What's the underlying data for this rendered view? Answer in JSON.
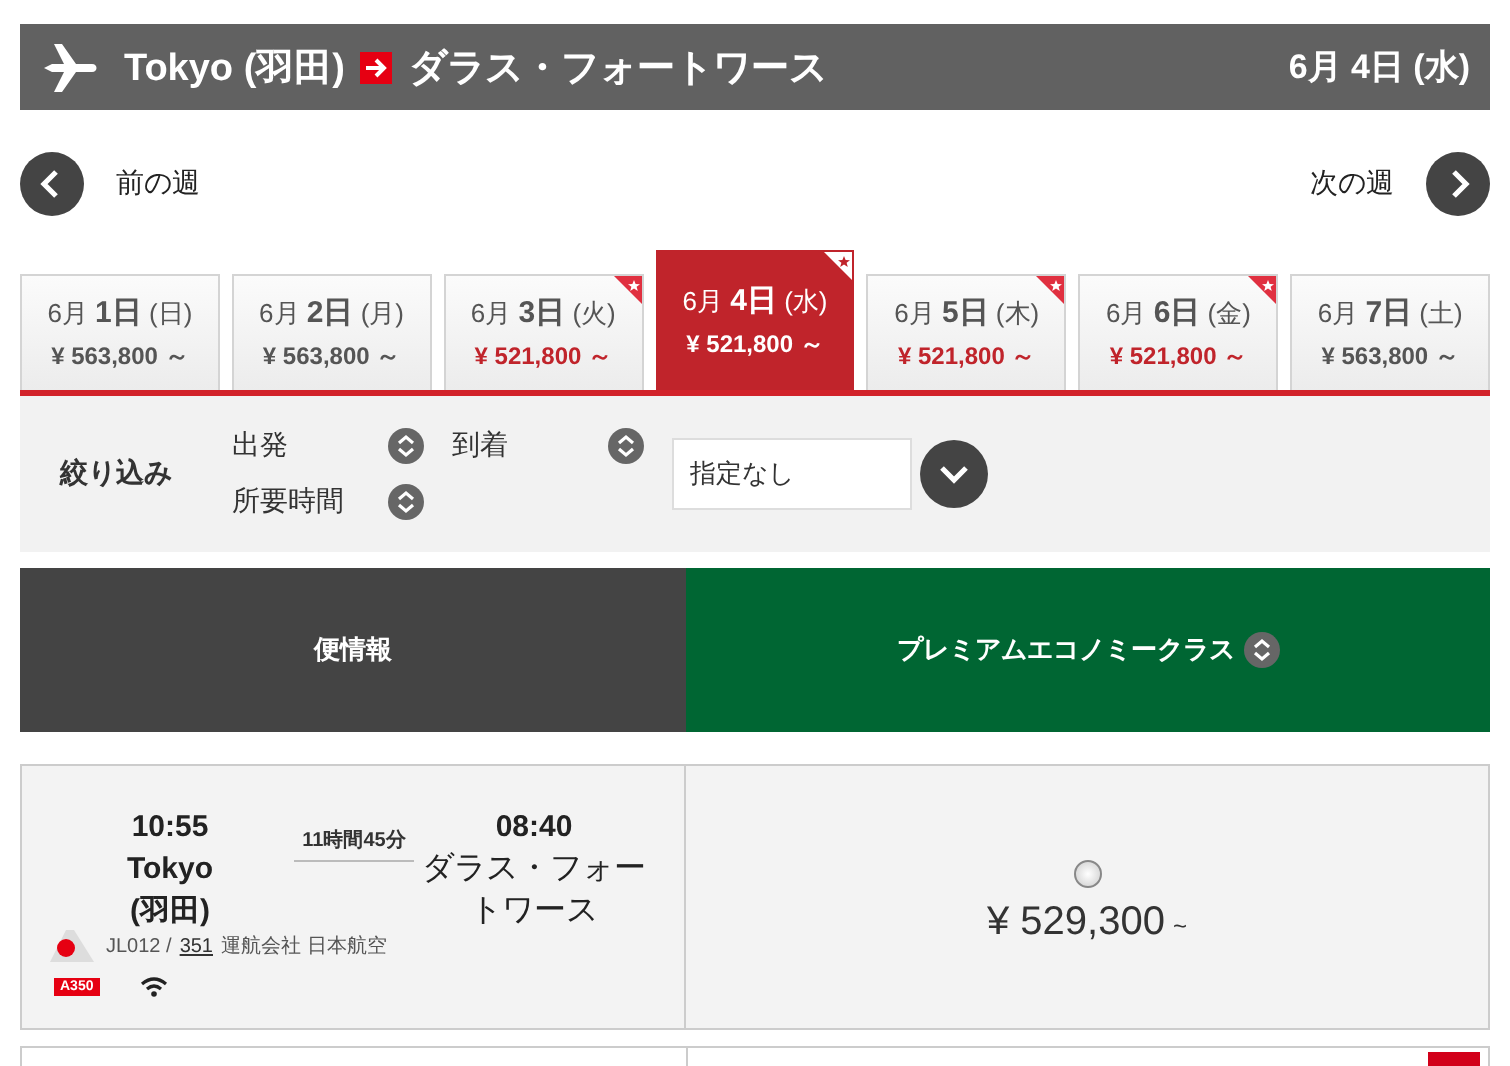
{
  "header": {
    "from": "Tokyo (羽田)",
    "to": "ダラス・フォートワース",
    "date": "6月 4日 (水)"
  },
  "week_nav": {
    "prev": "前の週",
    "next": "次の週"
  },
  "date_tabs": [
    {
      "date": "6月 **1日** (日)",
      "price": "¥ 563,800 ～",
      "selected": false,
      "cheapest": false
    },
    {
      "date": "6月 **2日** (月)",
      "price": "¥ 563,800 ～",
      "selected": false,
      "cheapest": false
    },
    {
      "date": "6月 **3日** (火)",
      "price": "¥ 521,800 ～",
      "selected": false,
      "cheapest": true
    },
    {
      "date": "6月 **4日** (水)",
      "price": "¥ 521,800 ～",
      "selected": true,
      "cheapest": true
    },
    {
      "date": "6月 **5日** (木)",
      "price": "¥ 521,800 ～",
      "selected": false,
      "cheapest": true
    },
    {
      "date": "6月 **6日** (金)",
      "price": "¥ 521,800 ～",
      "selected": false,
      "cheapest": true
    },
    {
      "date": "6月 **7日** (土)",
      "price": "¥ 563,800 ～",
      "selected": false,
      "cheapest": false
    }
  ],
  "filter": {
    "label": "絞り込み",
    "sorts": [
      "出発",
      "到着",
      "所要時間"
    ],
    "select_value": "指定なし"
  },
  "columns": [
    {
      "label": "便情報",
      "kind": "info"
    },
    {
      "label": "プレミアムエコノミークラス",
      "kind": "fare"
    }
  ],
  "flights": [
    {
      "dep_time": "10:55",
      "dep_city": "Tokyo",
      "dep_airport": "(羽田)",
      "duration": "11時間45分",
      "arr_time": "08:40",
      "arr_place": "ダラス・フォートワース",
      "flight_no": "JL012 /",
      "code_share": "351",
      "operator": "運航会社 日本航空",
      "aircraft": "A350",
      "wifi": true,
      "fare_selected": false,
      "price": "¥ 529,300",
      "price_suffix": "~"
    }
  ]
}
